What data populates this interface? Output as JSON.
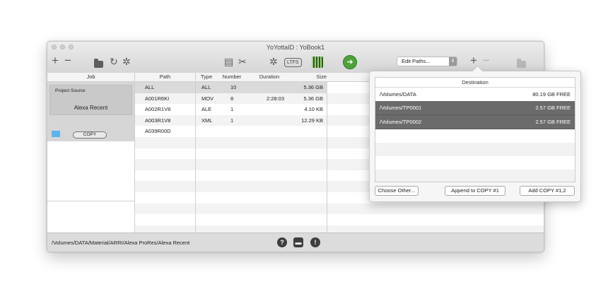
{
  "window": {
    "title": "YoYottaID : YoBook1"
  },
  "toolbar": {
    "add_icon": "plus-icon",
    "remove_icon": "minus-icon",
    "ltfs_label": "LTFS",
    "edit_paths_label": "Edit Paths..."
  },
  "columns": {
    "job": "Job",
    "path": "Path",
    "type": "Type",
    "number": "Number",
    "duration": "Duration",
    "size": "Size"
  },
  "job": {
    "source_label": "Project Source",
    "name": "Alexa Recent",
    "copy_label": "COPY"
  },
  "rows": [
    {
      "path": "ALL",
      "type": "ALL",
      "number": "10",
      "duration": "",
      "size": "5.36 GB"
    },
    {
      "path": "A001R6KI",
      "type": "MOV",
      "number": "8",
      "duration": "2:28:03",
      "size": "5.36 GB"
    },
    {
      "path": "A002R1V8",
      "type": "ALE",
      "number": "1",
      "duration": "",
      "size": "4.10 KB"
    },
    {
      "path": "A003R1V8",
      "type": "XML",
      "number": "1",
      "duration": "",
      "size": "12.29 KB"
    },
    {
      "path": "A039R00D",
      "type": "",
      "number": "",
      "duration": "",
      "size": ""
    }
  ],
  "status": {
    "path": "/Volumes/DATA/Material/ARRI/Alexa ProRes/Alexa Recent"
  },
  "destination": {
    "header": "Destination",
    "rows": [
      {
        "path": "/Volumes/DATA",
        "free": "80.19 GB FREE"
      },
      {
        "path": "/Volumes/TP0001",
        "free": "2.57 GB FREE"
      },
      {
        "path": "/Volumes/TP0002",
        "free": "2.57 GB FREE"
      }
    ],
    "choose_other": "Choose Other...",
    "append_copy": "Append to COPY #1",
    "add_copy": "Add COPY #1,2"
  },
  "colors": {
    "accent_green": "#4da33a",
    "selected_dark": "#6b6b6b",
    "swatch_blue": "#5ab4f0"
  }
}
